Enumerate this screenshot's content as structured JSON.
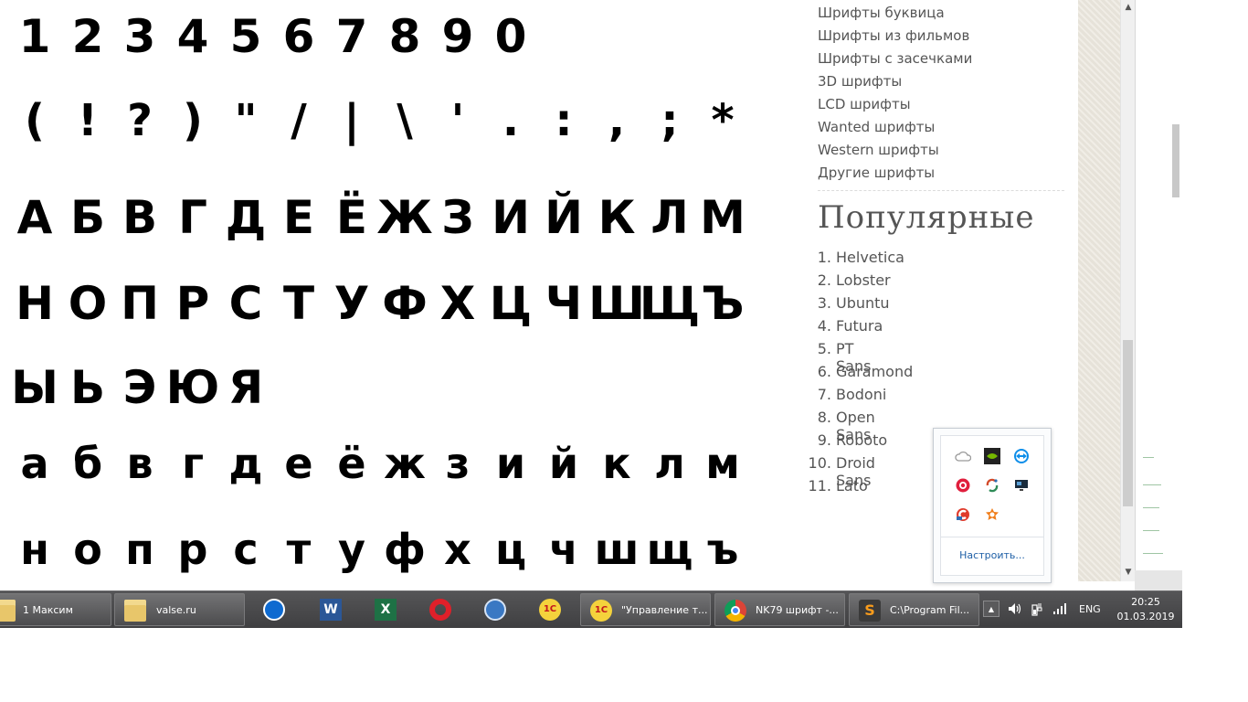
{
  "specimen": {
    "digits": [
      "1",
      "2",
      "3",
      "4",
      "5",
      "6",
      "7",
      "8",
      "9",
      "0"
    ],
    "symbols": [
      "(",
      "!",
      "?",
      ")",
      "\"",
      "/",
      "|",
      "\\",
      "'",
      ".",
      ":",
      ",",
      ";",
      "*"
    ],
    "upper_row1": [
      "А",
      "Б",
      "В",
      "Г",
      "Д",
      "Е",
      "Ё",
      "Ж",
      "З",
      "И",
      "Й",
      "К",
      "Л",
      "М"
    ],
    "upper_row2": [
      "Н",
      "О",
      "П",
      "Р",
      "С",
      "Т",
      "У",
      "Ф",
      "Х",
      "Ц",
      "Ч",
      "Ш",
      "Щ",
      "Ъ"
    ],
    "upper_row3": [
      "Ы",
      "Ь",
      "Э",
      "Ю",
      "Я"
    ],
    "lower_row1": [
      "а",
      "б",
      "в",
      "г",
      "д",
      "е",
      "ё",
      "ж",
      "з",
      "и",
      "й",
      "к",
      "л",
      "м"
    ],
    "lower_row2": [
      "н",
      "о",
      "п",
      "р",
      "с",
      "т",
      "у",
      "ф",
      "х",
      "ц",
      "ч",
      "ш",
      "щ",
      "ъ"
    ]
  },
  "sidebar": {
    "categories": [
      "Шрифты буквица",
      "Шрифты из фильмов",
      "Шрифты с засечками",
      "3D шрифты",
      "LCD шрифты",
      "Wanted шрифты",
      "Western шрифты",
      "Другие шрифты"
    ],
    "popular_title": "Популярные",
    "popular": [
      {
        "num": "1.",
        "name": "Helvetica"
      },
      {
        "num": "2.",
        "name": "Lobster"
      },
      {
        "num": "3.",
        "name": "Ubuntu"
      },
      {
        "num": "4.",
        "name": "Futura"
      },
      {
        "num": "5.",
        "name": "PT Sans"
      },
      {
        "num": "6.",
        "name": "Garamond"
      },
      {
        "num": "7.",
        "name": "Bodoni"
      },
      {
        "num": "8.",
        "name": "Open Sans"
      },
      {
        "num": "9.",
        "name": "Roboto"
      },
      {
        "num": "10.",
        "name": "Droid Sans"
      },
      {
        "num": "11.",
        "name": "Lato"
      }
    ]
  },
  "tray_popup": {
    "icons": [
      "onedrive-icon",
      "nvidia-icon",
      "teamviewer-icon",
      "beats-icon",
      "nubes-icon",
      "display-icon",
      "ccleaner-icon",
      "avast-icon"
    ],
    "configure_label": "Настроить..."
  },
  "taskbar": {
    "buttons": [
      {
        "label": "1 Максим",
        "icon": "folder-icon"
      },
      {
        "label": "valse.ru",
        "icon": "folder-icon"
      },
      {
        "label": "",
        "icon": "teamviewer-icon"
      },
      {
        "label": "",
        "icon": "word-icon"
      },
      {
        "label": "",
        "icon": "excel-icon"
      },
      {
        "label": "",
        "icon": "opera-icon"
      },
      {
        "label": "",
        "icon": "mail-icon"
      },
      {
        "label": "",
        "icon": "onec-icon"
      },
      {
        "label": "\"Управление т...",
        "icon": "onec-icon"
      },
      {
        "label": "NK79 шрифт -...",
        "icon": "chrome-icon"
      },
      {
        "label": "C:\\Program Fil...",
        "icon": "sublime-icon"
      }
    ],
    "word_letter": "W",
    "excel_letter": "X",
    "onec_letter": "1С",
    "sublime_letter": "S",
    "language": "ENG",
    "time": "20:25",
    "date": "01.03.2019"
  }
}
